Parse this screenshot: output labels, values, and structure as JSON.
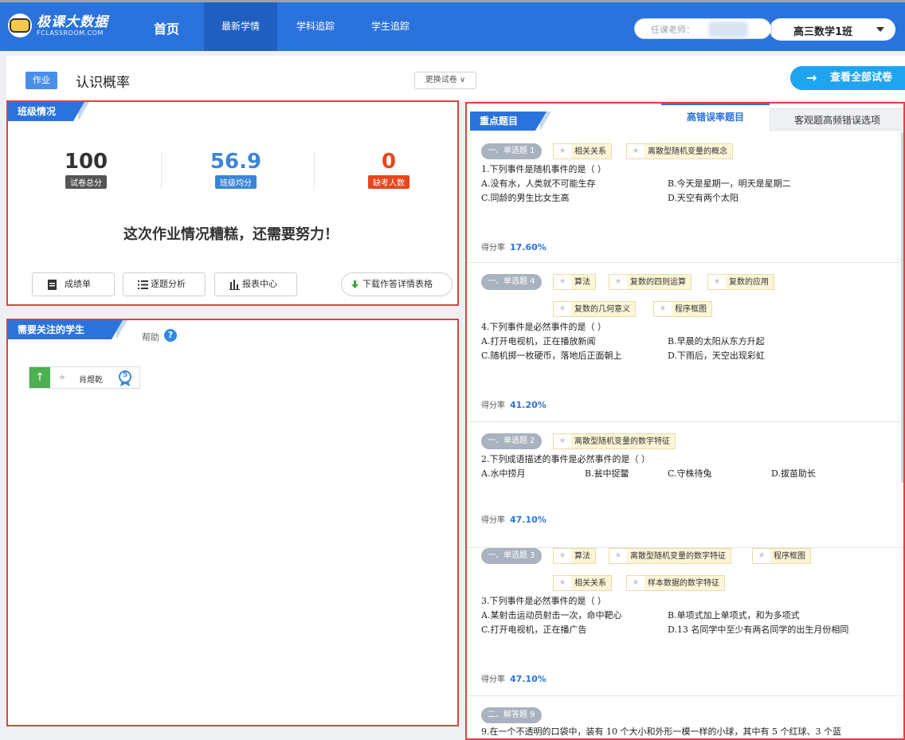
{
  "topbar": {
    "logo_main": "极课大数据",
    "logo_sub": "FCLASSROOM.COM",
    "home": "首页",
    "nav": [
      "最新学情",
      "学科追踪",
      "学生追踪"
    ],
    "teacher_label": "任课老师：",
    "class_name": "高三数学1班"
  },
  "header": {
    "tag": "作业",
    "title": "认识概率",
    "change_btn": "更换试卷 ∨",
    "view_all": "查看全部试卷",
    "view_all_arrow": "→"
  },
  "class_status": {
    "section_title": "班级情况",
    "stats": [
      {
        "value": "100",
        "label": "试卷总分",
        "color": "#333333",
        "label_bg": "#555555"
      },
      {
        "value": "56.9",
        "label": "班级均分",
        "color": "#3a86d8",
        "label_bg": "#3a86d8"
      },
      {
        "value": "0",
        "label": "缺考人数",
        "color": "#e8461c",
        "label_bg": "#e8461c"
      }
    ],
    "remark": "这次作业情况糟糕，还需要努力！",
    "buttons": [
      "成绩单",
      "逐题分析",
      "报表中心"
    ],
    "download": "下载作答详情表格"
  },
  "students": {
    "section_title": "需要关注的学生",
    "help": "帮助",
    "help_icon": "?",
    "up_icon": "↑",
    "star_icon": "★",
    "badge": "5",
    "list": [
      {
        "name": "肖煜乾"
      }
    ]
  },
  "key_questions": {
    "section_title": "重点题目",
    "tab_active": "高错误率题目",
    "tab_other": "客观题高频错误选项",
    "score_label": "得分率",
    "items": [
      {
        "type": "一、单选题 1",
        "tags": [
          "相关关系",
          "离散型随机变量的概念"
        ],
        "tags2": [],
        "stem": "1.下列事件是随机事件的是（    ）",
        "options": [
          "A.没有水，人类就不可能生存",
          "B.今天是星期一，明天是星期二",
          "C.同龄的男生比女生高",
          "D.天空有两个太阳"
        ],
        "rate": "17.60%"
      },
      {
        "type": "一、单选题 4",
        "tags": [
          "算法",
          "复数的四则运算",
          "复数的应用"
        ],
        "tags2": [
          "复数的几何意义",
          "程序框图"
        ],
        "stem": "4.下列事件是必然事件的是（    ）",
        "options": [
          "A.打开电视机，正在播放新闻",
          "B.早晨的太阳从东方升起",
          "C.随机掷一枚硬币，落地后正面朝上",
          "D.下雨后，天空出现彩虹"
        ],
        "rate": "41.20%"
      },
      {
        "type": "一、单选题 2",
        "tags": [
          "离散型随机变量的数字特征"
        ],
        "tags2": [],
        "stem": "2.下列成语描述的事件是必然事件的是（    ）",
        "options": [
          "A.水中捞月",
          "B.瓮中捉鳖",
          "C.守株待兔",
          "D.拔苗助长"
        ],
        "rate": "47.10%"
      },
      {
        "type": "一、单选题 3",
        "tags": [
          "算法",
          "离散型随机变量的数字特征",
          "程序框图"
        ],
        "tags2": [
          "相关关系",
          "样本数据的数字特征"
        ],
        "stem": "3.下列事件是必然事件的是（    ）",
        "options": [
          "A.某射击运动员射击一次，命中靶心",
          "B.单项式加上单项式，和为多项式",
          "C.打开电视机，正在播广告",
          "D.13 名同学中至少有两名同学的出生月份相同"
        ],
        "rate": "47.10%"
      },
      {
        "type": "二、解答题 9",
        "tags": [],
        "tags2": [],
        "stem": "9.在一个不透明的口袋中，装有 10 个大小和外形一模一样的小球，其中有 5 个红球、3 个蓝",
        "options": [],
        "rate": ""
      }
    ]
  }
}
